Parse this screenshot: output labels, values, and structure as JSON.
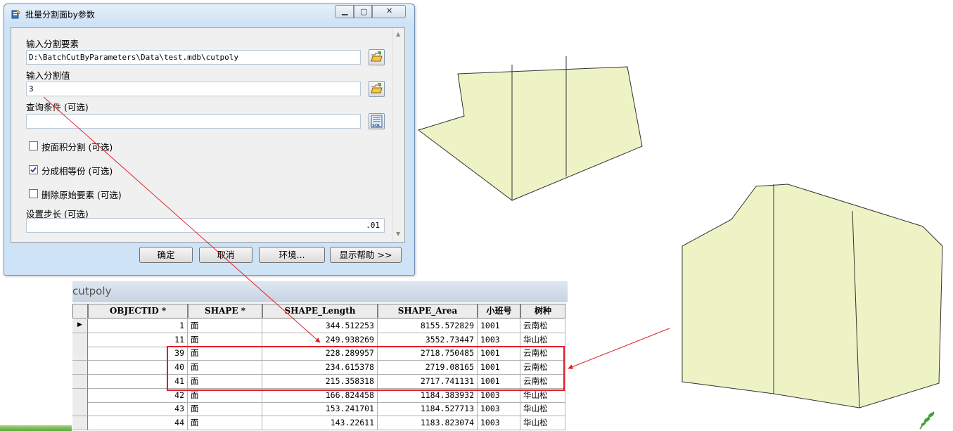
{
  "dialog": {
    "title": "批量分割面by参数",
    "fields": {
      "input_features_label": "输入分割要素",
      "input_features_value": "D:\\BatchCutByParameters\\Data\\test.mdb\\cutpoly",
      "split_value_label": "输入分割值",
      "split_value": "3",
      "query_label": "查询条件 (可选)",
      "query_value": "",
      "by_area_label": "按面积分割 (可选)",
      "equal_parts_label": "分成相等份 (可选)",
      "delete_original_label": "删除原始要素 (可选)",
      "step_label": "设置步长 (可选)",
      "step_value": ".01"
    },
    "checkboxes": {
      "by_area": false,
      "equal_parts": true,
      "delete_original": false
    },
    "buttons": {
      "ok": "确定",
      "cancel": "取消",
      "environments": "环境...",
      "show_help": "显示帮助 >>"
    },
    "sql_button_label": "SQL"
  },
  "table": {
    "title": "cutpoly",
    "columns": [
      "OBJECTID *",
      "SHAPE *",
      "SHAPE_Length",
      "SHAPE_Area",
      "小班号",
      "树种"
    ],
    "rows": [
      [
        "1",
        "面",
        "344.512253",
        "8155.572829",
        "1001",
        "云南松"
      ],
      [
        "11",
        "面",
        "249.938269",
        "3552.73447",
        "1003",
        "华山松"
      ],
      [
        "39",
        "面",
        "228.289957",
        "2718.750485",
        "1001",
        "云南松"
      ],
      [
        "40",
        "面",
        "234.615378",
        "2719.08165",
        "1001",
        "云南松"
      ],
      [
        "41",
        "面",
        "215.358318",
        "2717.741131",
        "1001",
        "云南松"
      ],
      [
        "42",
        "面",
        "166.824458",
        "1184.383932",
        "1003",
        "华山松"
      ],
      [
        "43",
        "面",
        "153.241701",
        "1184.527713",
        "1003",
        "华山松"
      ],
      [
        "44",
        "面",
        "143.22611",
        "1183.823074",
        "1003",
        "华山松"
      ]
    ],
    "current_row_marker": "▶"
  },
  "colors": {
    "polygon_fill": "#eef3c6",
    "annotation_red": "#e0202a"
  }
}
